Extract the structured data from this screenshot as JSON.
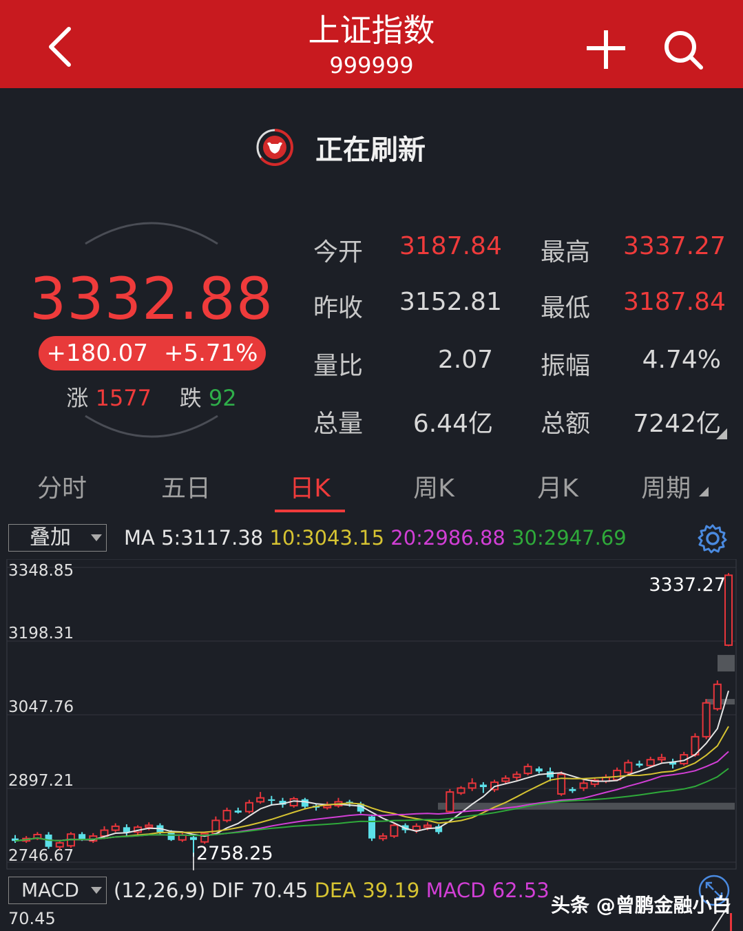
{
  "header": {
    "title": "上证指数",
    "code": "999999",
    "bg_color": "#c81a1f",
    "icons": [
      "back-chevron-icon",
      "plus-icon",
      "search-icon"
    ]
  },
  "refresh": {
    "label": "正在刷新",
    "icon": "bull-logo-icon"
  },
  "quote": {
    "price": "3332.88",
    "change": "+180.07",
    "change_pct": "+5.71%",
    "up_label": "涨",
    "up_count": "1577",
    "down_label": "跌",
    "down_count": "92",
    "up_color": "#ef3b3b",
    "down_color": "#2fae4a"
  },
  "stats": [
    {
      "label": "今开",
      "value": "3187.84",
      "color": "#ef3b3b"
    },
    {
      "label": "最高",
      "value": "3337.27",
      "color": "#ef3b3b"
    },
    {
      "label": "昨收",
      "value": "3152.81",
      "color": "#d8d8d8"
    },
    {
      "label": "最低",
      "value": "3187.84",
      "color": "#ef3b3b"
    },
    {
      "label": "量比",
      "value": "2.07",
      "color": "#d8d8d8"
    },
    {
      "label": "振幅",
      "value": "4.74%",
      "color": "#d8d8d8"
    },
    {
      "label": "总量",
      "value": "6.44亿",
      "color": "#d8d8d8"
    },
    {
      "label": "总额",
      "value": "7242亿",
      "color": "#d8d8d8"
    }
  ],
  "tabs": [
    {
      "label": "分时",
      "active": false
    },
    {
      "label": "五日",
      "active": false
    },
    {
      "label": "日K",
      "active": true
    },
    {
      "label": "周K",
      "active": false
    },
    {
      "label": "月K",
      "active": false
    },
    {
      "label": "周期",
      "active": false
    }
  ],
  "overlay": {
    "select_label": "叠加",
    "ma_prefix": "MA",
    "ma5_label": "5:3117.38",
    "ma5_color": "#e6e6e6",
    "ma10_label": "10:3043.15",
    "ma10_color": "#d6c332",
    "ma20_label": "20:2986.88",
    "ma20_color": "#d23fd6",
    "ma30_label": "30:2947.69",
    "ma30_color": "#2faa3a"
  },
  "chart_data": {
    "type": "candlestick",
    "y_axis_ticks": [
      "3348.85",
      "3198.31",
      "3047.76",
      "2897.21",
      "2746.67"
    ],
    "ylim": [
      2746.67,
      3348.85
    ],
    "high_label": "3337.27",
    "low_label": "2758.25",
    "up_color": "#e8353b",
    "down_color": "#5ce0e8",
    "candles": [
      [
        2795,
        2790,
        2802,
        2786
      ],
      [
        2790,
        2795,
        2800,
        2786
      ],
      [
        2795,
        2803,
        2808,
        2792
      ],
      [
        2803,
        2778,
        2808,
        2774
      ],
      [
        2778,
        2786,
        2790,
        2772
      ],
      [
        2780,
        2804,
        2808,
        2776
      ],
      [
        2804,
        2793,
        2808,
        2790
      ],
      [
        2790,
        2800,
        2806,
        2786
      ],
      [
        2800,
        2812,
        2820,
        2796
      ],
      [
        2812,
        2820,
        2826,
        2808
      ],
      [
        2818,
        2808,
        2824,
        2800
      ],
      [
        2808,
        2818,
        2822,
        2800
      ],
      [
        2818,
        2822,
        2828,
        2812
      ],
      [
        2822,
        2808,
        2826,
        2802
      ],
      [
        2808,
        2792,
        2812,
        2790
      ],
      [
        2792,
        2802,
        2806,
        2788
      ],
      [
        2798,
        2792,
        2802,
        2758
      ],
      [
        2788,
        2805,
        2808,
        2784
      ],
      [
        2805,
        2832,
        2840,
        2802
      ],
      [
        2832,
        2852,
        2858,
        2828
      ],
      [
        2852,
        2848,
        2858,
        2846
      ],
      [
        2850,
        2868,
        2874,
        2846
      ],
      [
        2870,
        2878,
        2890,
        2866
      ],
      [
        2875,
        2872,
        2882,
        2862
      ],
      [
        2872,
        2864,
        2878,
        2858
      ],
      [
        2862,
        2876,
        2880,
        2858
      ],
      [
        2875,
        2860,
        2878,
        2856
      ],
      [
        2862,
        2858,
        2866,
        2852
      ],
      [
        2858,
        2862,
        2870,
        2854
      ],
      [
        2862,
        2870,
        2878,
        2858
      ],
      [
        2870,
        2866,
        2874,
        2860
      ],
      [
        2866,
        2850,
        2870,
        2846
      ],
      [
        2840,
        2795,
        2844,
        2790
      ],
      [
        2795,
        2800,
        2806,
        2790
      ],
      [
        2800,
        2822,
        2826,
        2796
      ],
      [
        2822,
        2812,
        2826,
        2806
      ],
      [
        2812,
        2820,
        2826,
        2806
      ],
      [
        2818,
        2822,
        2828,
        2812
      ],
      [
        2820,
        2808,
        2824,
        2804
      ],
      [
        2850,
        2890,
        2896,
        2846
      ],
      [
        2888,
        2898,
        2902,
        2884
      ],
      [
        2898,
        2908,
        2918,
        2892
      ],
      [
        2905,
        2900,
        2910,
        2888
      ],
      [
        2895,
        2910,
        2915,
        2890
      ],
      [
        2912,
        2918,
        2924,
        2908
      ],
      [
        2920,
        2926,
        2932,
        2914
      ],
      [
        2928,
        2942,
        2948,
        2924
      ],
      [
        2938,
        2932,
        2942,
        2928
      ],
      [
        2932,
        2920,
        2940,
        2912
      ],
      [
        2886,
        2926,
        2932,
        2882
      ],
      [
        2896,
        2892,
        2900,
        2888
      ],
      [
        2898,
        2908,
        2914,
        2892
      ],
      [
        2906,
        2914,
        2918,
        2900
      ],
      [
        2912,
        2920,
        2926,
        2908
      ],
      [
        2915,
        2934,
        2940,
        2912
      ],
      [
        2930,
        2950,
        2956,
        2926
      ],
      [
        2948,
        2944,
        2954,
        2940
      ],
      [
        2944,
        2956,
        2962,
        2940
      ],
      [
        2956,
        2960,
        2968,
        2950
      ],
      [
        2952,
        2946,
        2958,
        2938
      ],
      [
        2948,
        2966,
        2972,
        2944
      ],
      [
        2966,
        3003,
        3010,
        2962
      ],
      [
        3003,
        3072,
        3080,
        2998
      ],
      [
        3060,
        3110,
        3118,
        3056
      ],
      [
        3190,
        3332.88,
        3337.27,
        3187.84
      ]
    ],
    "ma_series": [
      {
        "name": "5",
        "color": "#e6e6e6"
      },
      {
        "name": "10",
        "color": "#d6c332"
      },
      {
        "name": "20",
        "color": "#d23fd6"
      },
      {
        "name": "30",
        "color": "#2faa3a"
      }
    ]
  },
  "macd": {
    "select_label": "MACD",
    "params": "(12,26,9)",
    "dif_label": "DIF",
    "dif_value": "70.45",
    "dea_label": "DEA",
    "dea_value": "39.19",
    "macd_label": "MACD",
    "macd_value": "62.53",
    "axis_top": "70.45"
  },
  "watermark": "头条 @曾鹏金融小白"
}
